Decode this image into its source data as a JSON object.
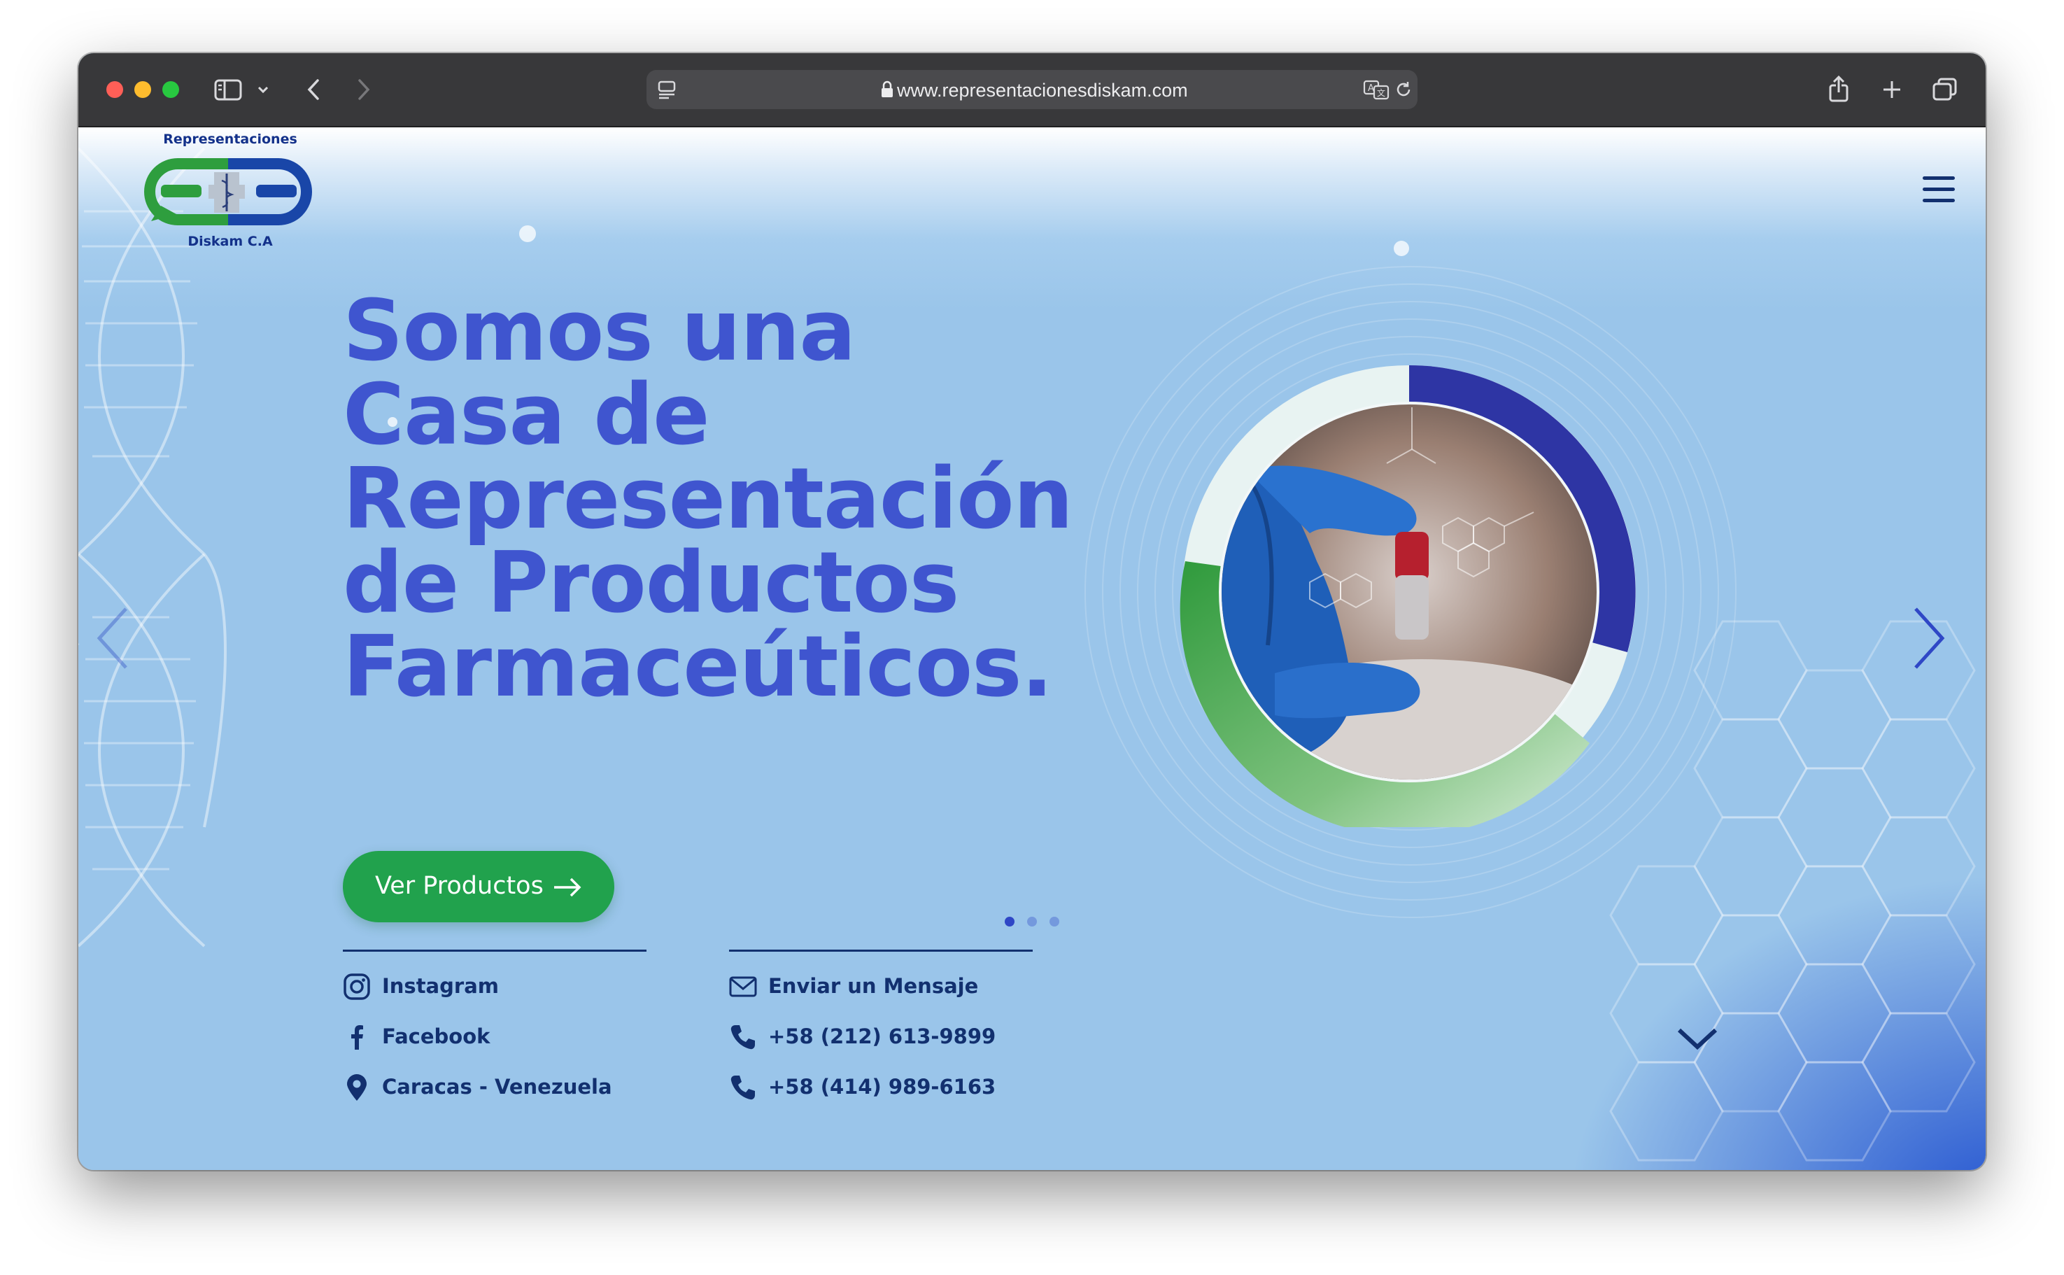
{
  "browser": {
    "url": "www.representacionesdiskam.com"
  },
  "brand": {
    "top_text": "Representaciones",
    "bottom_text": "Diskam C.A",
    "colors": {
      "green": "#2e9e3e",
      "blue": "#1946a8",
      "headline": "#3f55cf",
      "navy": "#12306f"
    }
  },
  "hero": {
    "headline_lines": [
      "Somos una",
      "Casa de",
      "Representación",
      "de Productos",
      "Farmaceúticos."
    ],
    "cta_label": "Ver Productos"
  },
  "contacts_left": [
    {
      "icon": "instagram-icon",
      "label": "Instagram"
    },
    {
      "icon": "facebook-icon",
      "label": "Facebook"
    },
    {
      "icon": "location-pin-icon",
      "label": "Caracas - Venezuela"
    }
  ],
  "contacts_right": [
    {
      "icon": "envelope-icon",
      "label": "Enviar un Mensaje"
    },
    {
      "icon": "phone-icon",
      "label": "+58 (212) 613-9899"
    },
    {
      "icon": "phone-icon",
      "label": "+58 (414) 989-6163"
    }
  ],
  "slider": {
    "slide_count": 3,
    "active_index": 0
  }
}
